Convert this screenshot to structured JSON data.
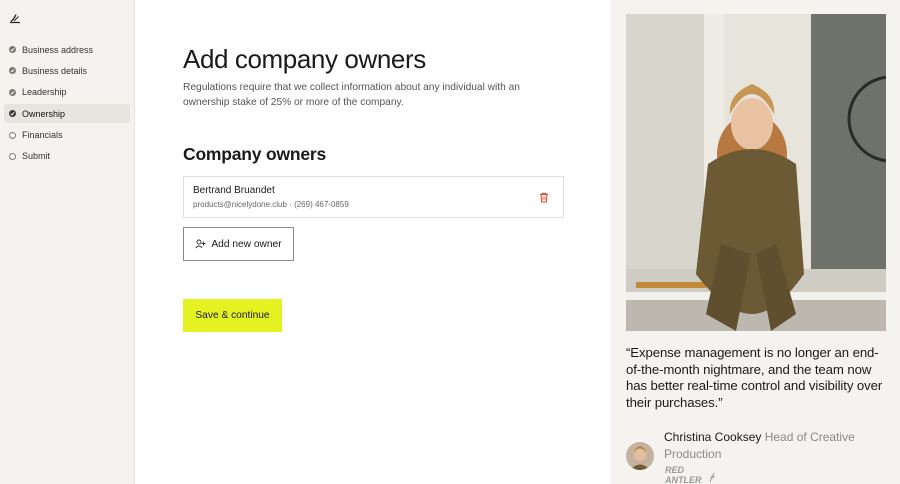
{
  "sidebar": {
    "steps": [
      {
        "label": "Business address",
        "status": "complete"
      },
      {
        "label": "Business details",
        "status": "complete"
      },
      {
        "label": "Leadership",
        "status": "complete"
      },
      {
        "label": "Ownership",
        "status": "current"
      },
      {
        "label": "Financials",
        "status": "incomplete"
      },
      {
        "label": "Submit",
        "status": "incomplete"
      }
    ]
  },
  "main": {
    "title": "Add company owners",
    "description": "Regulations require that we collect information about any individual with an ownership stake of 25% or more of the company.",
    "section_title": "Company owners",
    "owners": [
      {
        "name": "Bertrand Bruandet",
        "contact": "products@nicelydone.club · (269) 467-0859"
      }
    ],
    "add_owner_label": "Add new owner",
    "save_label": "Save & continue"
  },
  "testimonial": {
    "quote": "“Expense management is no longer an end-of-the-month nightmare, and the team now has better real-time control and visibility over their purchases.”",
    "name": "Christina Cooksey",
    "role": "Head of Creative Production",
    "company_logo": "RED ANTLER"
  },
  "colors": {
    "accent": "#e4f222",
    "sidebar_bg": "#f4f3ef",
    "panel_bg": "#f4f3ef",
    "step_done": "#767a6e",
    "delete": "#d9432c"
  }
}
